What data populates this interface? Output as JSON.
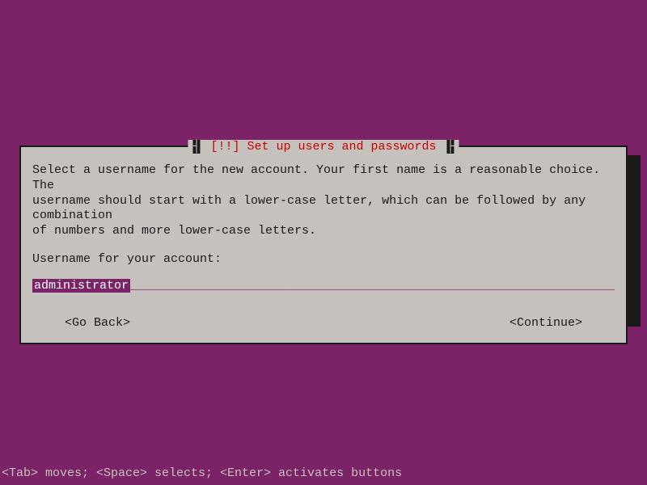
{
  "dialog": {
    "title": "[!!] Set up users and passwords",
    "instruction": "Select a username for the new account. Your first name is a reasonable choice. The\nusername should start with a lower-case letter, which can be followed by any combination\nof numbers and more lower-case letters.",
    "field_label": "Username for your account:",
    "input_value": "administrator",
    "buttons": {
      "back": "<Go Back>",
      "continue": "<Continue>"
    }
  },
  "statusbar": "<Tab> moves; <Space> selects; <Enter> activates buttons"
}
